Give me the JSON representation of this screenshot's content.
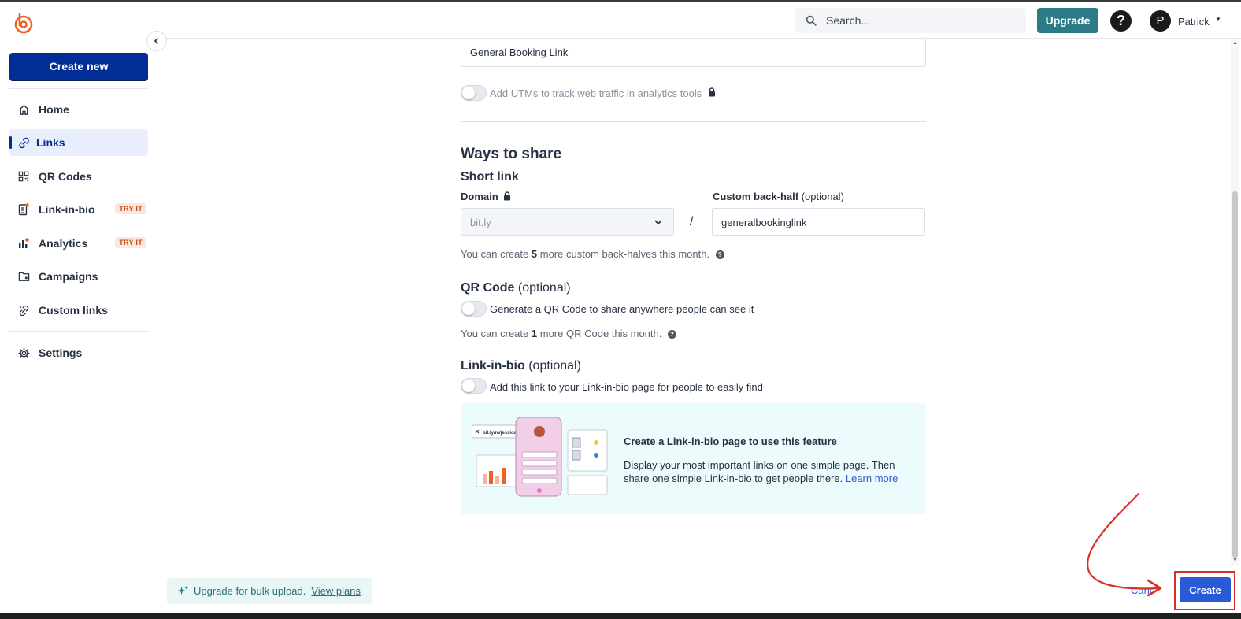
{
  "sidebar": {
    "create_new": "Create new",
    "items": [
      {
        "label": "Home"
      },
      {
        "label": "Links"
      },
      {
        "label": "QR Codes"
      },
      {
        "label": "Link-in-bio",
        "badge": "TRY IT"
      },
      {
        "label": "Analytics",
        "badge": "TRY IT"
      },
      {
        "label": "Campaigns"
      },
      {
        "label": "Custom links"
      },
      {
        "label": "Settings"
      }
    ],
    "active_item": "Links"
  },
  "topbar": {
    "search_placeholder": "Search...",
    "upgrade": "Upgrade",
    "help": "?",
    "avatar_initial": "P",
    "user_name": "Patrick"
  },
  "form": {
    "title_value": "General Booking Link",
    "utm_label": "Add UTMs to track web traffic in analytics tools",
    "ways_to_share": "Ways to share",
    "short_link": "Short link",
    "domain_label": "Domain",
    "domain_value": "bit.ly",
    "backhalf_label": "Custom back-half",
    "backhalf_optional": "(optional)",
    "backhalf_value": "generalbookinglink",
    "slash": "/",
    "backhalf_note_pre": "You can create",
    "backhalf_note_count": "5",
    "backhalf_note_post": "more custom back-halves this month.",
    "qr_title": "QR Code",
    "qr_optional": "(optional)",
    "qr_toggle_label": "Generate a QR Code to share anywhere people can see it",
    "qr_note_pre": "You can create",
    "qr_note_count": "1",
    "qr_note_post": "more QR Code this month.",
    "lib_title": "Link-in-bio",
    "lib_optional": "(optional)",
    "lib_toggle_label": "Add this link to your Link-in-bio page for people to easily find",
    "lib_card_title": "Create a Link-in-bio page to use this feature",
    "lib_card_text": "Display your most important links on one simple page. Then share one simple Link-in-bio to get people there.",
    "lib_card_link": "Learn more",
    "illus_url": "bit.ly/m/jessicastar"
  },
  "footer": {
    "bulk_text": "Upgrade for bulk upload.",
    "bulk_link": "View plans",
    "cancel": "Canc",
    "create": "Create"
  },
  "colors": {
    "brand_blue": "#022d94",
    "teal": "#2a7a87",
    "action_blue": "#2a5bd7",
    "annotation_red": "#d93025",
    "orange": "#ee6123"
  }
}
